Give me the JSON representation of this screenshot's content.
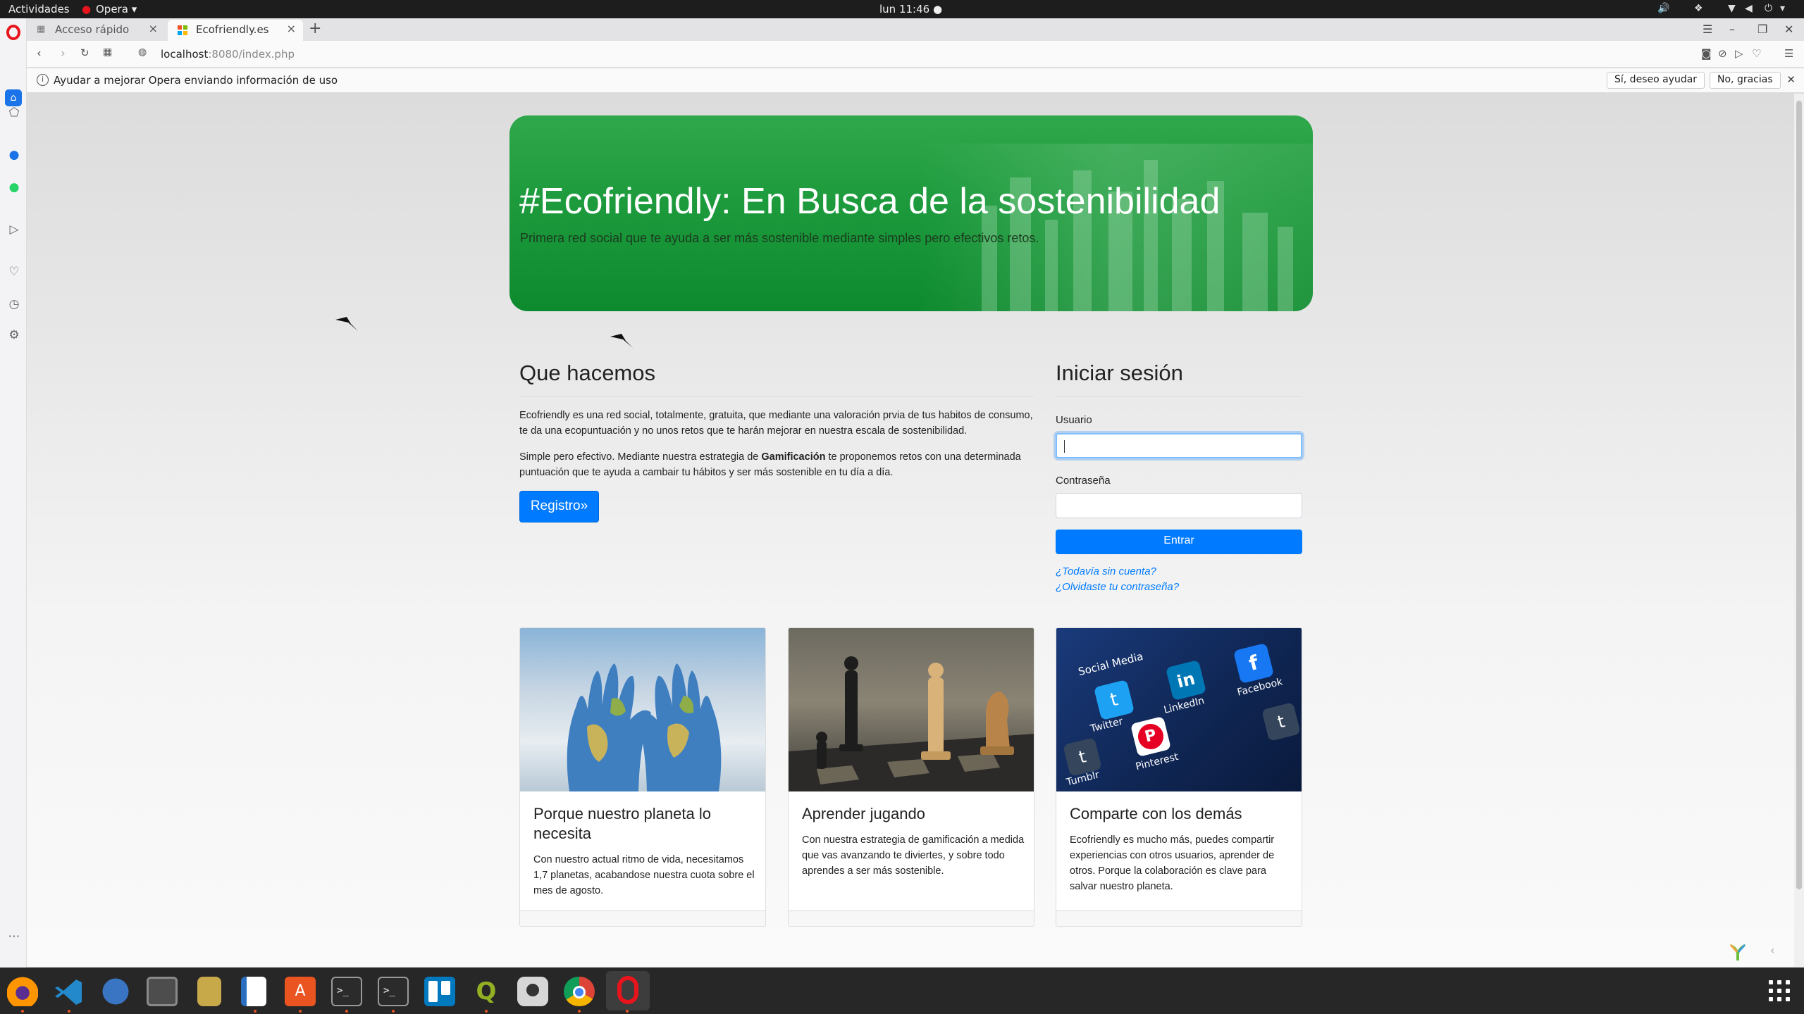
{
  "system": {
    "activities": "Actividades",
    "app_menu": "Opera",
    "clock": "lun 11:46"
  },
  "tabs": [
    {
      "label": "Acceso rápido",
      "active": false
    },
    {
      "label": "Ecofriendly.es",
      "active": true
    }
  ],
  "address": {
    "host": "localhost",
    "rest": ":8080/index.php"
  },
  "notification": {
    "text": "Ayudar a mejorar Opera enviando información de uso",
    "accept": "Sí, deseo ayudar",
    "decline": "No, gracias"
  },
  "hero": {
    "title": "#Ecofriendly: En Busca de la sostenibilidad",
    "subtitle": "Primera red social que te ayuda a ser más sostenible mediante simples pero efectivos retos."
  },
  "about": {
    "heading": "Que hacemos",
    "p1": "Ecofriendly es una red social, totalmente, gratuita, que mediante una valoración prvia de tus habitos de consumo, te da una ecopuntuación y no unos retos que te harán mejorar en nuestra escala de sostenibilidad.",
    "p2_before": "Simple pero efectivo. Mediante nuestra estrategia de ",
    "p2_bold": "Gamificación",
    "p2_after": " te proponemos retos con una determinada puntuación que te ayuda a cambair tu hábitos y ser más sostenible en tu día a día.",
    "register_button": "Registro»"
  },
  "login": {
    "heading": "Iniciar sesión",
    "user_label": "Usuario",
    "user_value": "",
    "pass_label": "Contraseña",
    "pass_value": "",
    "submit": "Entrar",
    "no_account": "¿Todavía sin cuenta?",
    "forgot": "¿Olvidaste tu contraseña?"
  },
  "cards": [
    {
      "title": "Porque nuestro planeta lo necesita",
      "text": "Con nuestro actual ritmo de vida, necesitamos 1,7 planetas, acabandose nuestra cuota sobre el mes de agosto."
    },
    {
      "title": "Aprender jugando",
      "text": "Con nuestra estrategia de gamificación a medida que vas avanzando te diviertes, y sobre todo aprendes a ser más sostenible."
    },
    {
      "title": "Comparte con los demás",
      "text": "Ecofriendly es mucho más, puedes compartir experiencias con otros usuarios, aprender de otros. Porque la colaboración es clave para salvar nuestro planeta.",
      "image_labels": {
        "header": "Social Media",
        "twitter": "Twitter",
        "linkedin": "LinkedIn",
        "facebook": "Facebook",
        "tumblr": "Tumblr",
        "pinterest": "Pinterest"
      }
    }
  ],
  "colors": {
    "primary": "#007bff",
    "hero_green": "#1c9a3c",
    "opera_red": "#e8141c"
  }
}
